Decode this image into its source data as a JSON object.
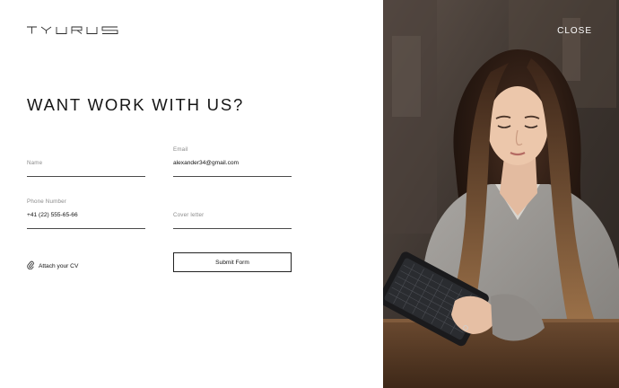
{
  "brand": {
    "logo_text": "TYURUS"
  },
  "header": {
    "close_label": "CLOSE"
  },
  "form": {
    "title": "WANT WORK WITH US?",
    "name": {
      "label": "Name",
      "value": ""
    },
    "email": {
      "label": "Email",
      "value": "alexander34@gmail.com"
    },
    "phone": {
      "label": "Phone Number",
      "value": "+41 (22) 555-65-66"
    },
    "cover": {
      "label": "Cover letter",
      "value": ""
    },
    "attach_label": "Attach your CV",
    "submit_label": "Submit Form"
  },
  "icons": {
    "attach": "paperclip-icon"
  },
  "colors": {
    "background": "#ffffff",
    "text": "#111111",
    "line": "#4a4a4a",
    "label": "#8a8a8a"
  }
}
